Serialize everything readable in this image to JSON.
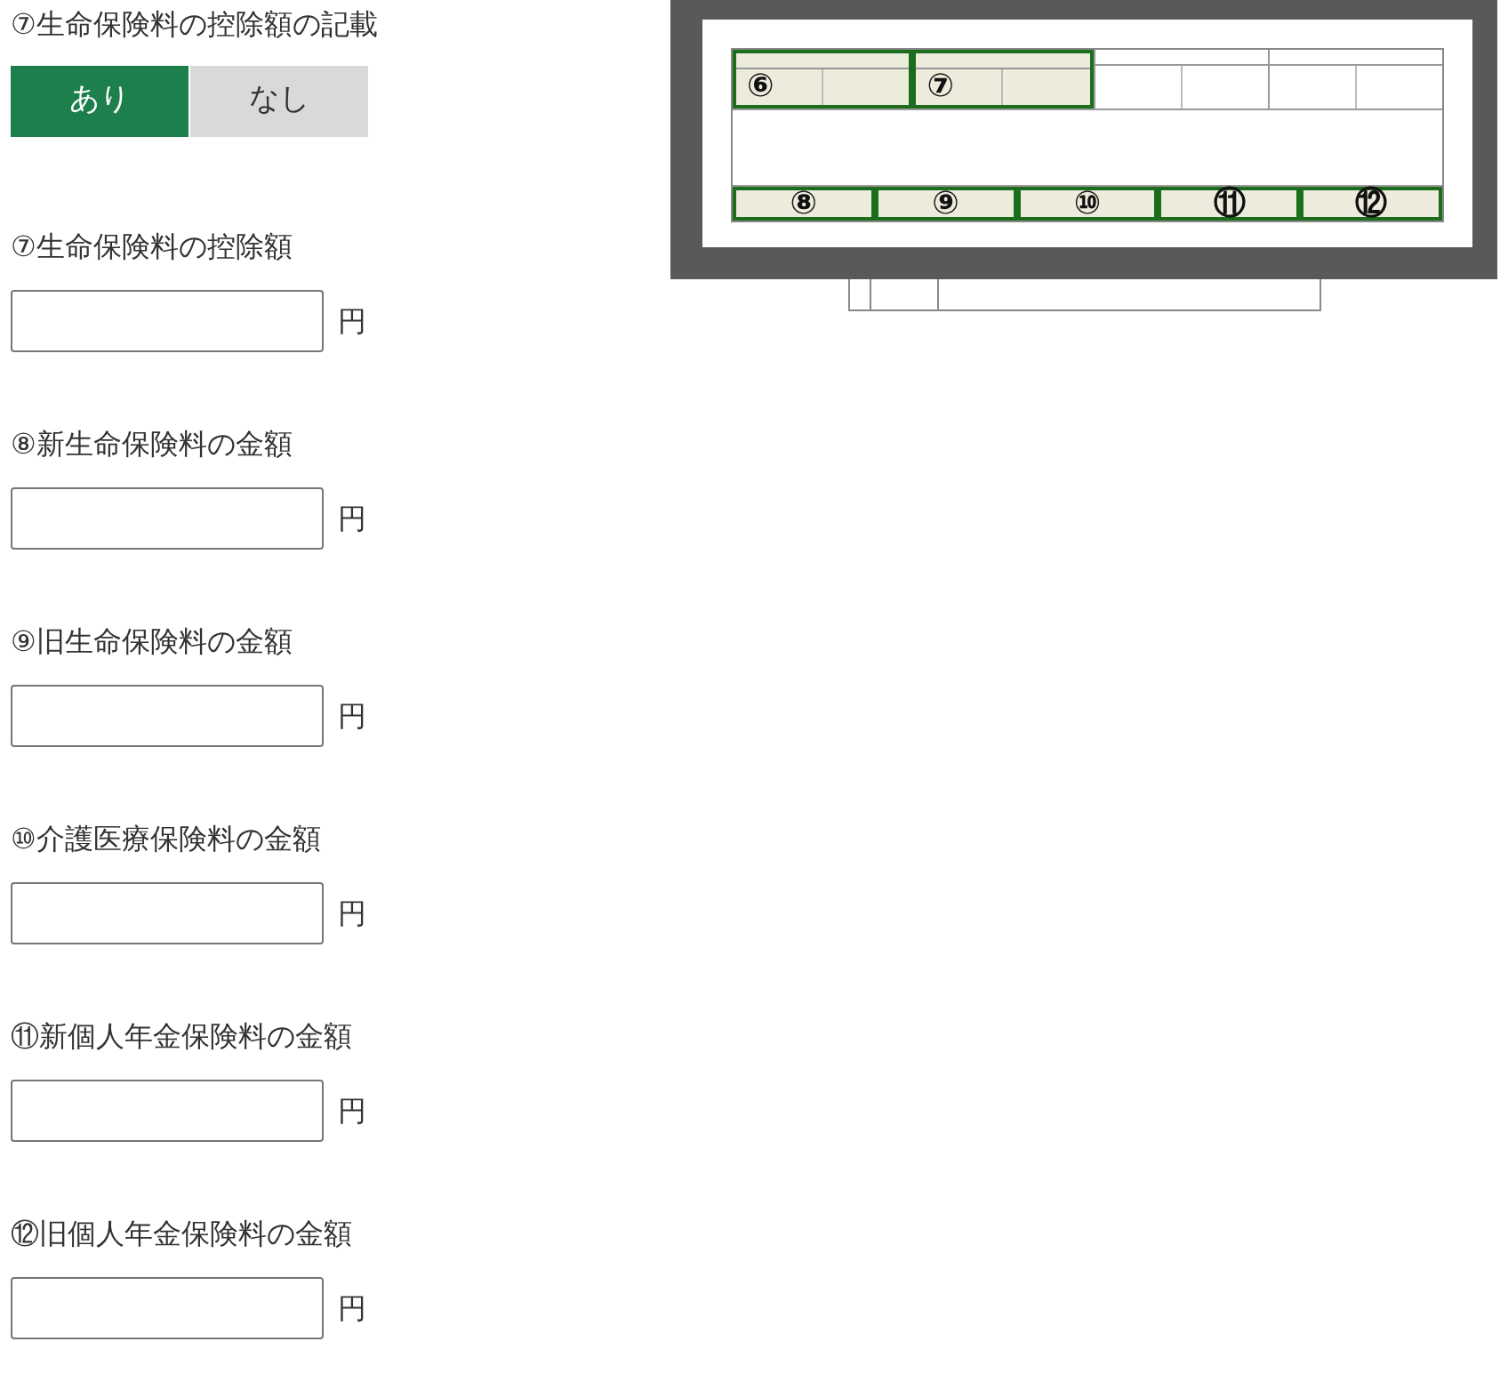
{
  "toggle": {
    "label": "⑦生命保険料の控除額の記載",
    "options": [
      {
        "label": "あり",
        "selected": true
      },
      {
        "label": "なし",
        "selected": false
      }
    ]
  },
  "fields": [
    {
      "label": "⑦生命保険料の控除額",
      "unit": "円"
    },
    {
      "label": "⑧新生命保険料の金額",
      "unit": "円"
    },
    {
      "label": "⑨旧生命保険料の金額",
      "unit": "円"
    },
    {
      "label": "⑩介護医療保険料の金額",
      "unit": "円"
    },
    {
      "label": "⑪新個人年金保険料の金額",
      "unit": "円"
    },
    {
      "label": "⑫旧個人年金保険料の金額",
      "unit": "円"
    }
  ],
  "form_image": {
    "top_numbers": [
      "⑥",
      "⑦"
    ],
    "bottom_numbers": [
      "⑧",
      "⑨",
      "⑩",
      "⑪",
      "⑫"
    ]
  }
}
